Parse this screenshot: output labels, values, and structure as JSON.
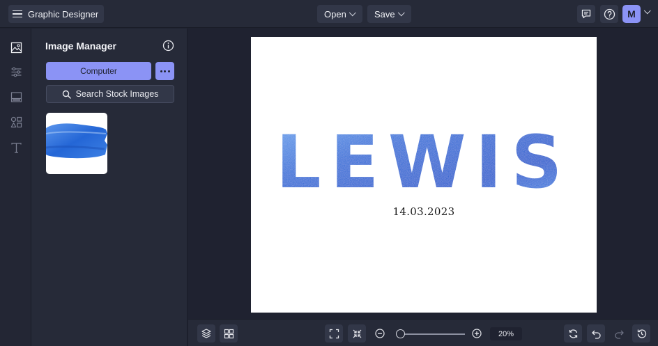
{
  "topbar": {
    "app_title": "Graphic Designer",
    "open_label": "Open",
    "save_label": "Save",
    "avatar_initial": "M"
  },
  "rail": {
    "items": [
      "image-icon",
      "sliders-icon",
      "layout-icon",
      "shapes-icon",
      "text-icon"
    ]
  },
  "panel": {
    "title": "Image Manager",
    "computer_label": "Computer",
    "stock_label": "Search Stock Images"
  },
  "canvas": {
    "headline": "LEWIS",
    "date": "14.03.2023"
  },
  "bottombar": {
    "zoom_value": "20%",
    "zoom_fraction": 0.05
  },
  "colors": {
    "accent": "#8b93f5",
    "bg": "#1f2230",
    "panel": "#262a38",
    "watercolor": "#2e6fd8"
  }
}
